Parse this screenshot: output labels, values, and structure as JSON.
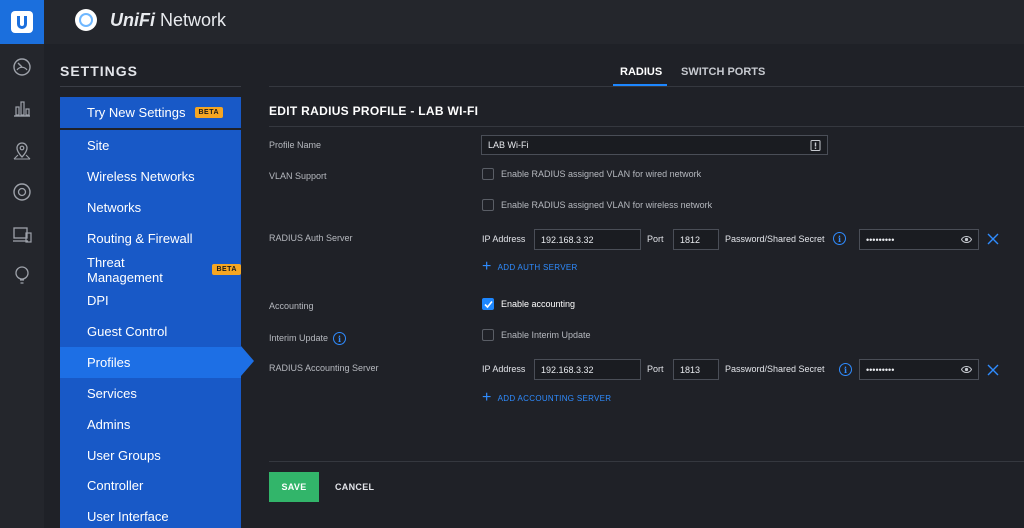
{
  "app": {
    "brand": "UniFi",
    "name": "Network"
  },
  "rail": {
    "icons": [
      "dashboard-icon",
      "statistics-icon",
      "map-icon",
      "devices-icon",
      "clients-icon",
      "insights-icon"
    ]
  },
  "sidebar": {
    "title": "SETTINGS",
    "items": [
      {
        "label": "Try New Settings",
        "badge": "BETA"
      },
      {
        "label": "Site"
      },
      {
        "label": "Wireless Networks"
      },
      {
        "label": "Networks"
      },
      {
        "label": "Routing & Firewall"
      },
      {
        "label": "Threat Management",
        "badge": "BETA"
      },
      {
        "label": "DPI"
      },
      {
        "label": "Guest Control"
      },
      {
        "label": "Profiles"
      },
      {
        "label": "Services"
      },
      {
        "label": "Admins"
      },
      {
        "label": "User Groups"
      },
      {
        "label": "Controller"
      },
      {
        "label": "User Interface"
      }
    ],
    "active": "Profiles"
  },
  "tabs": [
    {
      "label": "RADIUS"
    },
    {
      "label": "SWITCH PORTS"
    }
  ],
  "form": {
    "title": "EDIT RADIUS PROFILE - LAB WI-FI",
    "profile_name_label": "Profile Name",
    "profile_name_value": "LAB Wi-Fi",
    "vlan_label": "VLAN Support",
    "vlan_wired": "Enable RADIUS assigned VLAN for wired network",
    "vlan_wireless": "Enable RADIUS assigned VLAN for wireless network",
    "auth_label": "RADIUS Auth Server",
    "ip_label": "IP Address",
    "port_label": "Port",
    "secret_label": "Password/Shared Secret",
    "auth_ip": "192.168.3.32",
    "auth_port": "1812",
    "auth_secret": "•••••••••",
    "add_auth": "ADD AUTH SERVER",
    "accounting_label": "Accounting",
    "accounting_check": "Enable accounting",
    "interim_label": "Interim Update",
    "interim_check": "Enable Interim Update",
    "acct_label": "RADIUS Accounting Server",
    "acct_ip": "192.168.3.32",
    "acct_port": "1813",
    "acct_secret": "•••••••••",
    "add_acct": "ADD ACCOUNTING SERVER"
  },
  "actions": {
    "save": "SAVE",
    "cancel": "CANCEL"
  },
  "colors": {
    "accent": "#1d87ff",
    "sidebar": "#1859c7",
    "sidebar_active": "#1d6fe5",
    "save": "#32b56a",
    "beta": "#f5a623"
  }
}
